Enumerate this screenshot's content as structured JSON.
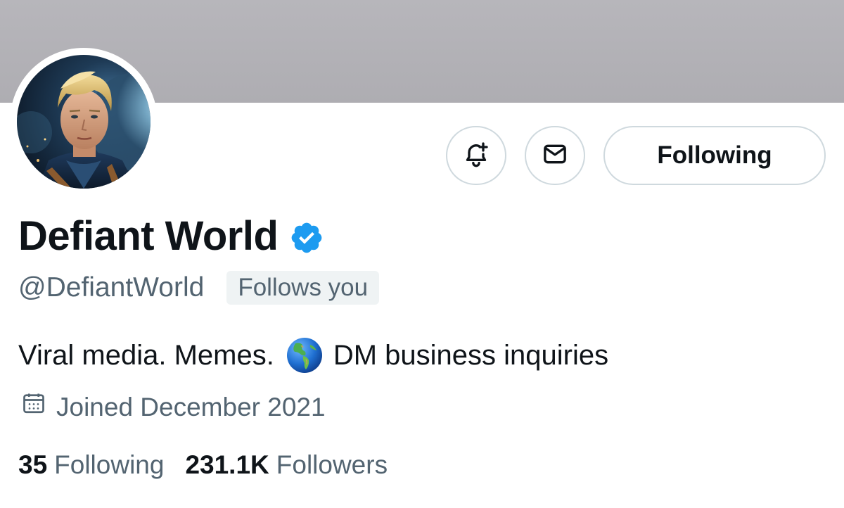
{
  "profile": {
    "display_name": "Defiant World",
    "handle": "@DefiantWorld",
    "follows_you_label": "Follows you",
    "verified": true,
    "bio_before": "Viral media. Memes.",
    "bio_after": "DM business inquiries",
    "joined": "Joined December 2021"
  },
  "actions": {
    "notify_icon": "bell-plus-icon",
    "message_icon": "envelope-icon",
    "following_label": "Following"
  },
  "stats": {
    "following_count": "35",
    "following_label": "Following",
    "followers_count": "231.1K",
    "followers_label": "Followers"
  },
  "colors": {
    "banner": "#b7b6bb",
    "text_primary": "#0f1419",
    "text_secondary": "#536471",
    "verified_blue": "#1d9bf0",
    "button_border": "#cfd9de"
  }
}
